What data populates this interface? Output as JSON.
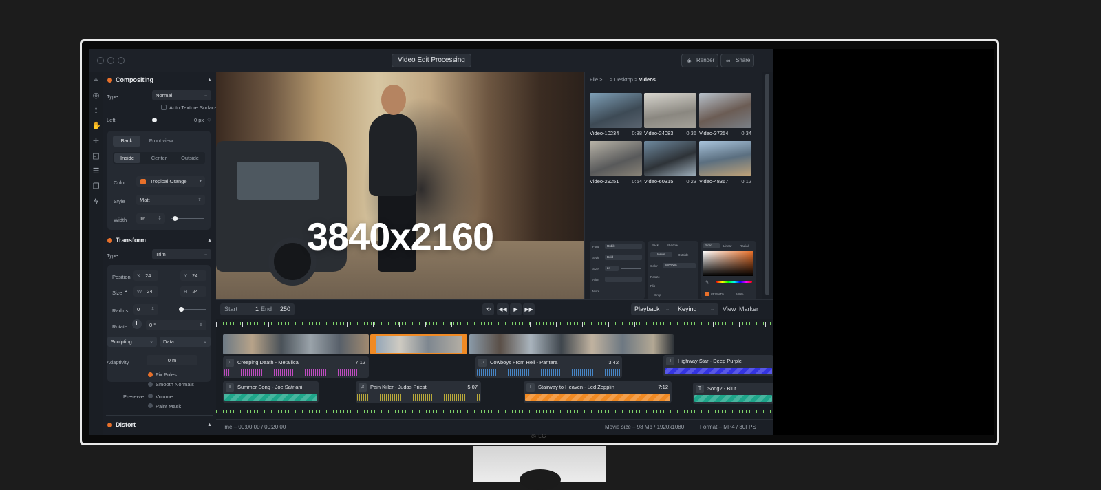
{
  "window": {
    "title": "Video Edit Processing",
    "render_label": "Render",
    "share_label": "Share"
  },
  "brand": "LG",
  "tools": [
    "select-tool-icon",
    "globe-icon",
    "node-path-icon",
    "hand-icon",
    "move-icon",
    "shape-icon",
    "align-icon",
    "layers-icon",
    "lightning-icon"
  ],
  "inspector": {
    "compositing": {
      "title": "Compositing",
      "type_label": "Type",
      "type_value": "Normal",
      "auto_texture_label": "Auto Texture Surface",
      "left_label": "Left",
      "left_value": "0 px",
      "view_tabs": [
        "Back",
        "Front view"
      ],
      "position_tabs": [
        "Inside",
        "Center",
        "Outside"
      ],
      "color_label": "Color",
      "color_value": "Tropical Orange",
      "color_hex": "#e8702a",
      "style_label": "Style",
      "style_value": "Matt",
      "width_label": "Width",
      "width_value": "16"
    },
    "transform": {
      "title": "Transform",
      "type_label": "Type",
      "type_value": "Trim",
      "position_label": "Position",
      "x_label": "X",
      "x_value": "24",
      "y_label": "Y",
      "y_value": "24",
      "size_label": "Size",
      "w_label": "W",
      "w_value": "24",
      "h_label": "H",
      "h_value": "24",
      "radius_label": "Radius",
      "radius_value": "0",
      "rotate_label": "Rotate",
      "rotate_value": "0 °"
    },
    "sculpt": {
      "mode_value": "Sculpting",
      "data_value": "Data",
      "adaptivity_label": "Adaptivity",
      "adaptivity_value": "0 m",
      "fix_poles_label": "Fix Poles",
      "smooth_normals_label": "Smooth Normals",
      "preserve_label": "Preserve",
      "volume_label": "Volume",
      "paint_mask_label": "Paint Mask"
    },
    "distort": {
      "title": "Distort"
    }
  },
  "preview": {
    "resolution_overlay": "3840x2160"
  },
  "browser": {
    "breadcrumb_path": "File > ... > Desktop > ",
    "breadcrumb_current": "Videos",
    "videos": [
      {
        "name": "Video-10234",
        "duration": "0:38"
      },
      {
        "name": "Video-24083",
        "duration": "0:36"
      },
      {
        "name": "Video-37254",
        "duration": "0:34"
      },
      {
        "name": "Video-29251",
        "duration": "0:54"
      },
      {
        "name": "Video-60315",
        "duration": "0:23"
      },
      {
        "name": "Video-48367",
        "duration": "0:12"
      }
    ],
    "mini_text": {
      "font_label": "Font",
      "font_value": "Rubik",
      "style_label": "Style",
      "style_value": "Bold",
      "size_label": "Size",
      "size_value": "24",
      "align_label": "Align",
      "more_label": "More"
    },
    "mini_fill": {
      "back_label": "Back",
      "shadow_label": "Shadow",
      "inside_label": "Inside",
      "outside_label": "Outside",
      "color_label": "Color",
      "color_value": "#000000",
      "resize_label": "Resize",
      "flip_label": "Flip",
      "crop_label": "Crop"
    },
    "mini_picker": {
      "tabs": [
        "Solid",
        "Linear",
        "Radial"
      ],
      "hex_value": "#F7SAT9",
      "opacity_value": "100%"
    }
  },
  "transport": {
    "start_label": "Start",
    "start_value": "1",
    "end_label": "End",
    "end_value": "250",
    "playback_label": "Playback",
    "keying_label": "Keying",
    "view_label": "View",
    "marker_label": "Marker"
  },
  "tracks": [
    {
      "name": "Creeping Death - Metallica",
      "duration": "7:12",
      "color": "#d14fd0"
    },
    {
      "name": "Cowboys From Hell - Pantera",
      "duration": "3:42",
      "color": "#4a8fd6"
    },
    {
      "name": "Highway Star - Deep Purple",
      "duration": "",
      "color": "#3434e0"
    },
    {
      "name": "Summer Song - Joe Satriani",
      "duration": "",
      "color": "#1fa58a"
    },
    {
      "name": "Pain Killer - Judas Priest",
      "duration": "5:07",
      "color": "#c9b73a"
    },
    {
      "name": "Stairway to Heaven - Led Zepplin",
      "duration": "7:12",
      "color": "#f08a24"
    },
    {
      "name": "Song2 - Blur",
      "duration": "",
      "color": "#1fa58a"
    }
  ],
  "status": {
    "time": "Time – 00:00:00 / 00:20:00",
    "movie_size": "Movie size – 98 Mb / 1920x1080",
    "format": "Format – MP4 / 30FPS"
  },
  "colors": {
    "accent": "#e8702a",
    "panel": "#1b1f26"
  }
}
